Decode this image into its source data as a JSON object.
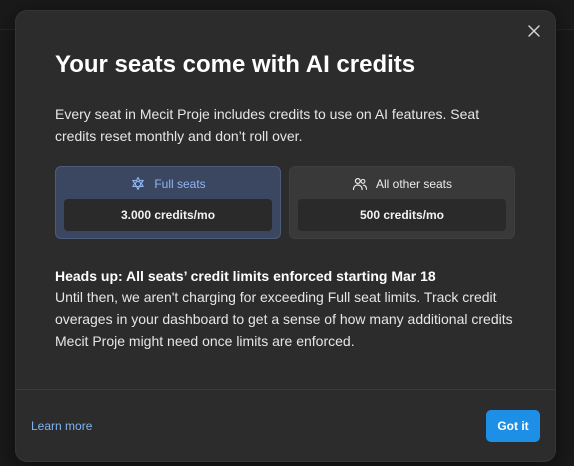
{
  "modal": {
    "title": "Your seats come with AI credits",
    "intro": "Every seat in Mecit Proje includes credits to use on AI features. Seat credits reset monthly and don’t roll over.",
    "close_icon": "close-icon"
  },
  "seats": {
    "full": {
      "label": "Full seats",
      "credits": "3.000 credits/mo",
      "icon": "full-seat-icon",
      "accent": "#8fb6f0"
    },
    "other": {
      "label": "All other seats",
      "credits": "500 credits/mo",
      "icon": "users-icon"
    }
  },
  "notice": {
    "title": "Heads up: All seats’ credit limits enforced starting Mar 18",
    "body": "Until then, we aren't charging for exceeding Full seat limits. Track credit overages in your dashboard to get a sense of how many additional credits Mecit Proje might need once limits are enforced."
  },
  "footer": {
    "learn_more": "Learn more",
    "got_it": "Got it",
    "link_color": "#7db4f5",
    "button_color": "#1d8fe6"
  }
}
